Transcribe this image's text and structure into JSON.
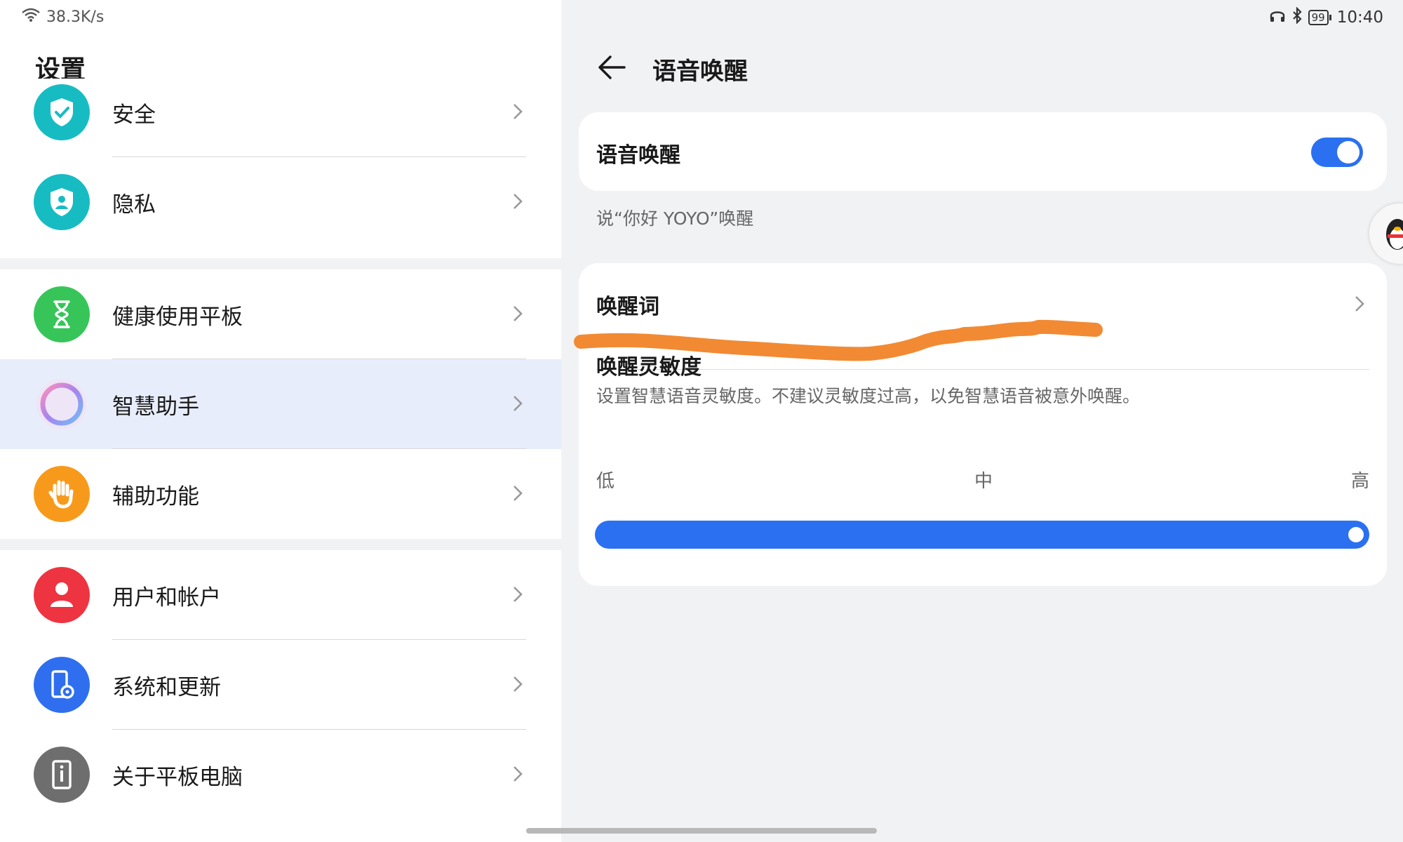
{
  "status": {
    "net_speed": "38.3K/s",
    "battery": "99",
    "time": "10:40"
  },
  "left": {
    "title": "设置",
    "items": [
      {
        "label": "安全",
        "icon": "shield-check-icon",
        "color": "#17bcc3"
      },
      {
        "label": "隐私",
        "icon": "privacy-shield-icon",
        "color": "#17bcc3"
      },
      {
        "label": "健康使用平板",
        "icon": "hourglass-icon",
        "color": "#37c55a"
      },
      {
        "label": "智慧助手",
        "icon": "assistant-ring-icon",
        "color": "#8a6cf0",
        "active": true
      },
      {
        "label": "辅助功能",
        "icon": "hand-icon",
        "color": "#f79a1b"
      },
      {
        "label": "用户和帐户",
        "icon": "user-icon",
        "color": "#ee3440"
      },
      {
        "label": "系统和更新",
        "icon": "phone-gear-icon",
        "color": "#2f6fef"
      },
      {
        "label": "关于平板电脑",
        "icon": "info-device-icon",
        "color": "#6e6e6e"
      }
    ]
  },
  "right": {
    "title": "语音唤醒",
    "voice_wakeup": {
      "label": "语音唤醒",
      "enabled": true
    },
    "hint": "说“你好 YOYO”唤醒",
    "wake_word": {
      "label": "唤醒词"
    },
    "sensitivity": {
      "label": "唤醒灵敏度",
      "description": "设置智慧语音灵敏度。不建议灵敏度过高，以免智慧语音被意外唤醒。",
      "levels": [
        "低",
        "中",
        "高"
      ],
      "value": 1.0
    }
  },
  "colors": {
    "accent": "#2a70f0",
    "annotation": "#f28a33"
  }
}
